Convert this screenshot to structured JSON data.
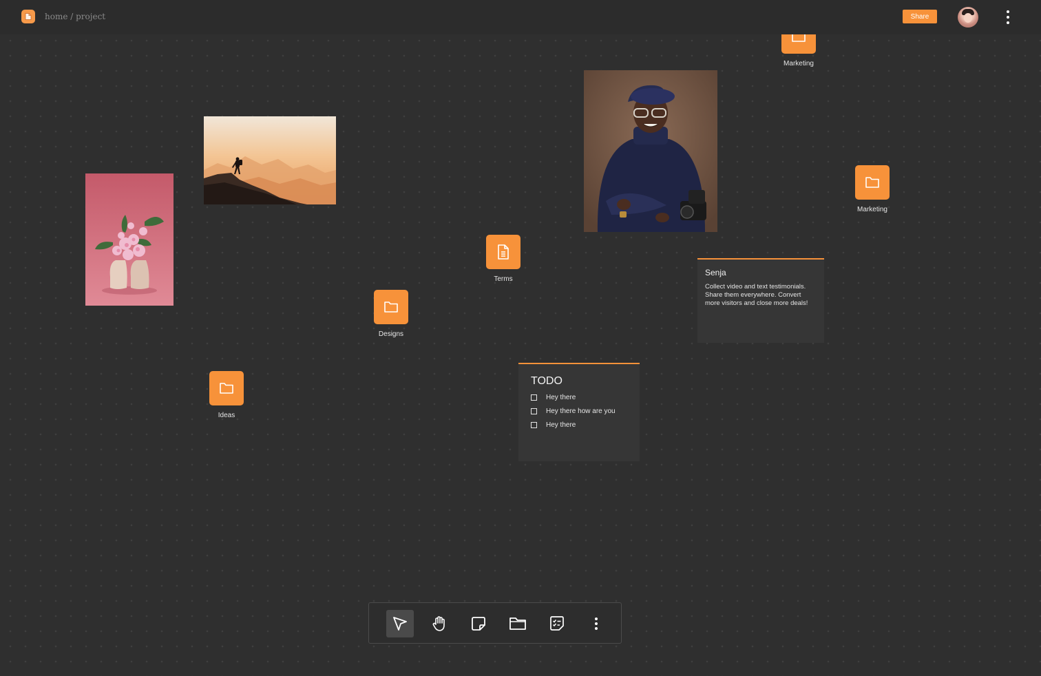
{
  "header": {
    "breadcrumb": "home / project",
    "share_label": "Share",
    "logo_icon": "document-logo-icon",
    "menu_icon": "more-vertical-icon"
  },
  "canvas": {
    "folders": [
      {
        "label": "Marketing",
        "icon": "folder-icon"
      },
      {
        "label": "Marketing",
        "icon": "folder-icon"
      },
      {
        "label": "Designs",
        "icon": "folder-icon"
      },
      {
        "label": "Ideas",
        "icon": "folder-icon"
      }
    ],
    "documents": [
      {
        "label": "Terms",
        "icon": "document-icon"
      }
    ],
    "images": [
      {
        "name": "hiker-mountain-photo"
      },
      {
        "name": "flowers-in-boots-photo"
      },
      {
        "name": "man-with-camera-portrait"
      }
    ],
    "note": {
      "title": "Senja",
      "body": "Collect video and text testimonials. Share them everywhere. Convert more visitors and close more deals!"
    },
    "todo": {
      "title": "TODO",
      "items": [
        "Hey there",
        "Hey there how are you",
        "Hey there"
      ]
    }
  },
  "toolbar": {
    "tools": [
      "select-cursor-icon",
      "hand-pan-icon",
      "note-icon",
      "folder-icon",
      "checklist-icon",
      "more-vertical-icon"
    ],
    "active": "select-cursor-icon"
  },
  "colors": {
    "accent": "#f7923a",
    "background": "#2f2f2f",
    "card": "#363636"
  }
}
